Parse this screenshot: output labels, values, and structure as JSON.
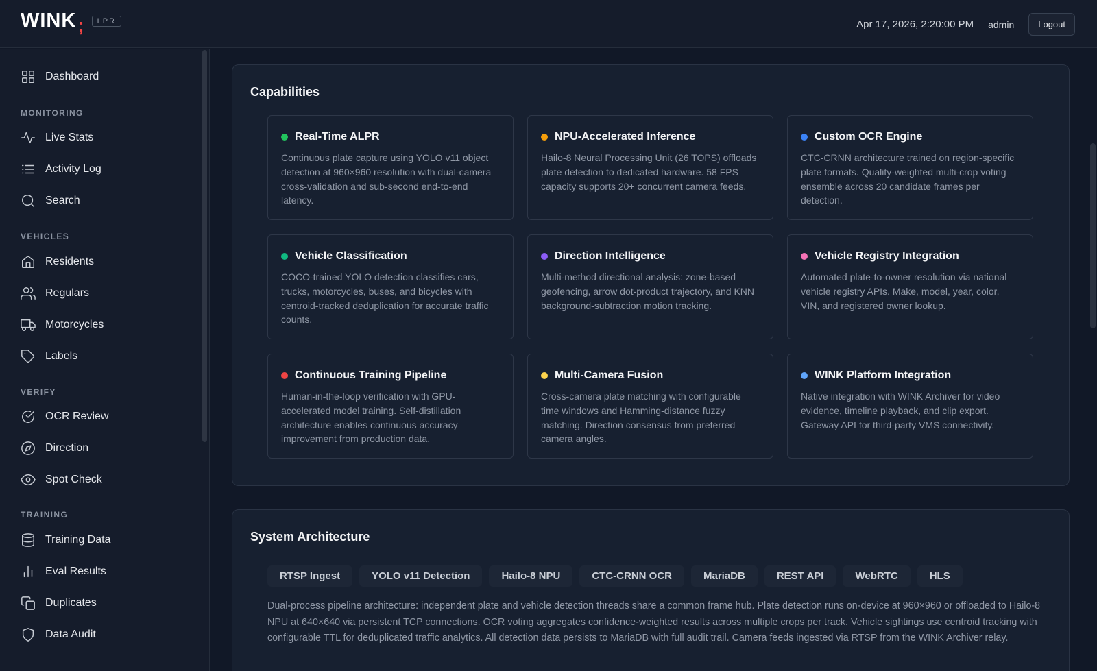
{
  "header": {
    "logo_text": "WINK",
    "logo_mark": ";",
    "logo_badge": "LPR",
    "datetime": "Apr 17, 2026, 2:20:00 PM",
    "user": "admin",
    "logout_label": "Logout"
  },
  "sidebar": {
    "dashboard": "Dashboard",
    "sections": {
      "monitoring": "MONITORING",
      "vehicles": "VEHICLES",
      "verify": "VERIFY",
      "training": "TRAINING"
    },
    "items": {
      "live_stats": "Live Stats",
      "activity_log": "Activity Log",
      "search": "Search",
      "residents": "Residents",
      "regulars": "Regulars",
      "motorcycles": "Motorcycles",
      "labels": "Labels",
      "ocr_review": "OCR Review",
      "direction": "Direction",
      "spot_check": "Spot Check",
      "training_data": "Training Data",
      "eval_results": "Eval Results",
      "duplicates": "Duplicates",
      "data_audit": "Data Audit"
    }
  },
  "capabilities": {
    "title": "Capabilities",
    "cards": [
      {
        "title": "Real-Time ALPR",
        "color": "#22c55e",
        "desc": "Continuous plate capture using YOLO v11 object detection at 960×960 resolution with dual-camera cross-validation and sub-second end-to-end latency."
      },
      {
        "title": "NPU-Accelerated Inference",
        "color": "#f59e0b",
        "desc": "Hailo-8 Neural Processing Unit (26 TOPS) offloads plate detection to dedicated hardware. 58 FPS capacity supports 20+ concurrent camera feeds."
      },
      {
        "title": "Custom OCR Engine",
        "color": "#3b82f6",
        "desc": "CTC-CRNN architecture trained on region-specific plate formats. Quality-weighted multi-crop voting ensemble across 20 candidate frames per detection."
      },
      {
        "title": "Vehicle Classification",
        "color": "#10b981",
        "desc": "COCO-trained YOLO detection classifies cars, trucks, motorcycles, buses, and bicycles with centroid-tracked deduplication for accurate traffic counts."
      },
      {
        "title": "Direction Intelligence",
        "color": "#8b5cf6",
        "desc": "Multi-method directional analysis: zone-based geofencing, arrow dot-product trajectory, and KNN background-subtraction motion tracking."
      },
      {
        "title": "Vehicle Registry Integration",
        "color": "#f472b6",
        "desc": "Automated plate-to-owner resolution via national vehicle registry APIs. Make, model, year, color, VIN, and registered owner lookup."
      },
      {
        "title": "Continuous Training Pipeline",
        "color": "#ef4444",
        "desc": "Human-in-the-loop verification with GPU-accelerated model training. Self-distillation architecture enables continuous accuracy improvement from production data."
      },
      {
        "title": "Multi-Camera Fusion",
        "color": "#fcd34d",
        "desc": "Cross-camera plate matching with configurable time windows and Hamming-distance fuzzy matching. Direction consensus from preferred camera angles."
      },
      {
        "title": "WINK Platform Integration",
        "color": "#60a5fa",
        "desc": "Native integration with WINK Archiver for video evidence, timeline playback, and clip export. Gateway API for third-party VMS connectivity."
      }
    ]
  },
  "architecture": {
    "title": "System Architecture",
    "tags": [
      "RTSP Ingest",
      "YOLO v11 Detection",
      "Hailo-8 NPU",
      "CTC-CRNN OCR",
      "MariaDB",
      "REST API",
      "WebRTC",
      "HLS"
    ],
    "description": "Dual-process pipeline architecture: independent plate and vehicle detection threads share a common frame hub. Plate detection runs on-device at 960×960 or offloaded to Hailo-8 NPU at 640×640 via persistent TCP connections. OCR voting aggregates confidence-weighted results across multiple crops per track. Vehicle sightings use centroid tracking with configurable TTL for deduplicated traffic analytics. All detection data persists to MariaDB with full audit trail. Camera feeds ingested via RTSP from the WINK Archiver relay."
  }
}
